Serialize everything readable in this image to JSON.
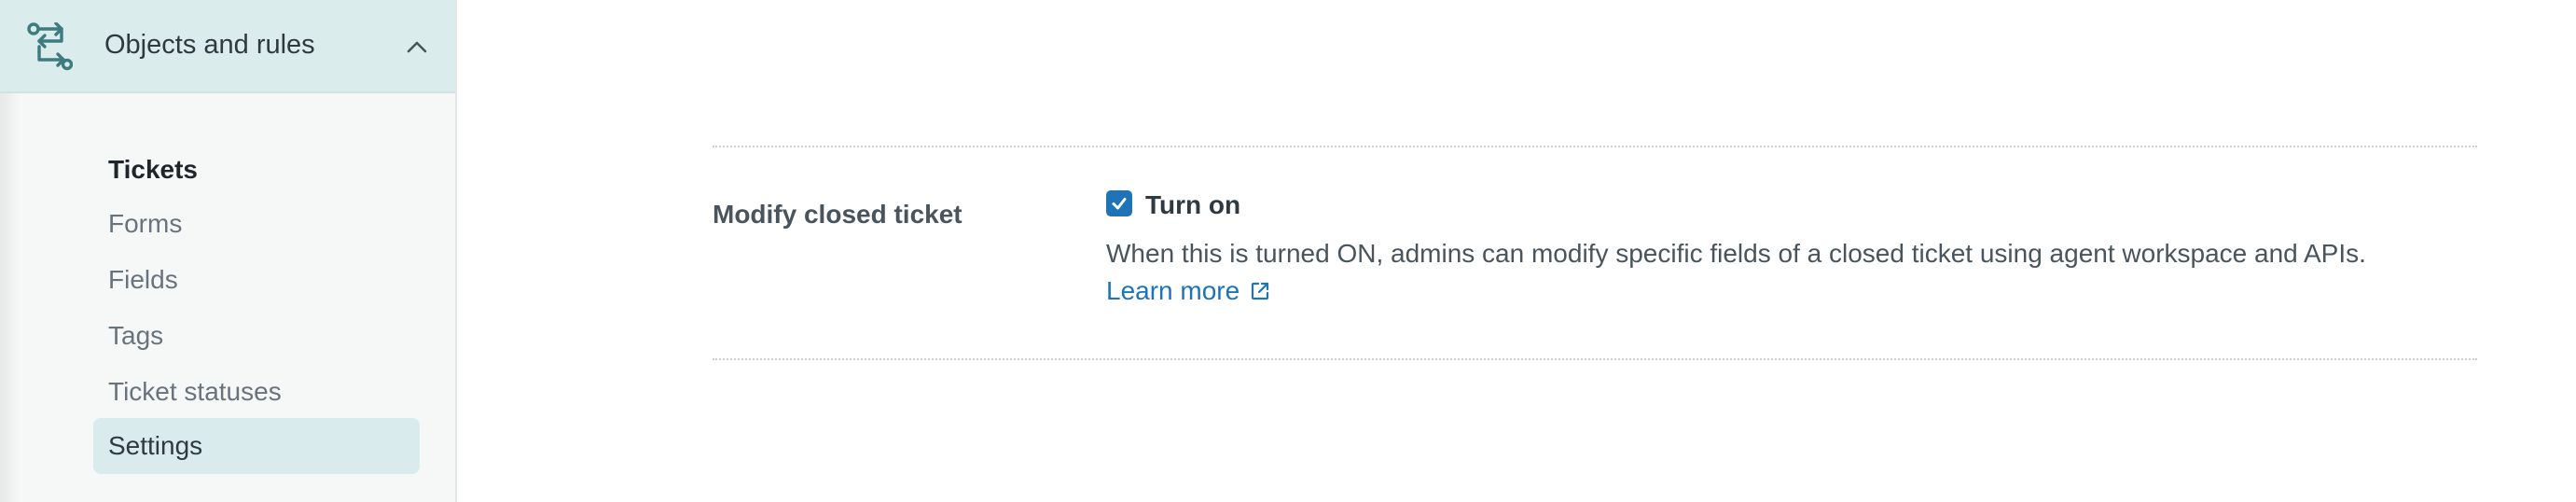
{
  "sidebar": {
    "section": {
      "title": "Objects and rules",
      "icon": "objects-rules-icon",
      "expanded": true
    },
    "nav": {
      "header": "Tickets",
      "items": [
        {
          "label": "Forms"
        },
        {
          "label": "Fields"
        },
        {
          "label": "Tags"
        },
        {
          "label": "Ticket statuses"
        },
        {
          "label": "Settings"
        }
      ],
      "active": "Settings"
    }
  },
  "setting": {
    "label": "Modify closed ticket",
    "checkbox_label": "Turn on",
    "checked": true,
    "description": "When this is turned ON, admins can modify specific fields of a closed ticket using agent workspace and APIs.",
    "learn_more": "Learn more"
  },
  "colors": {
    "accent": "#1f73b7",
    "sidebar_active": "#d9ebec",
    "section_header": "#dbeced",
    "icon": "#3d7b7f"
  }
}
